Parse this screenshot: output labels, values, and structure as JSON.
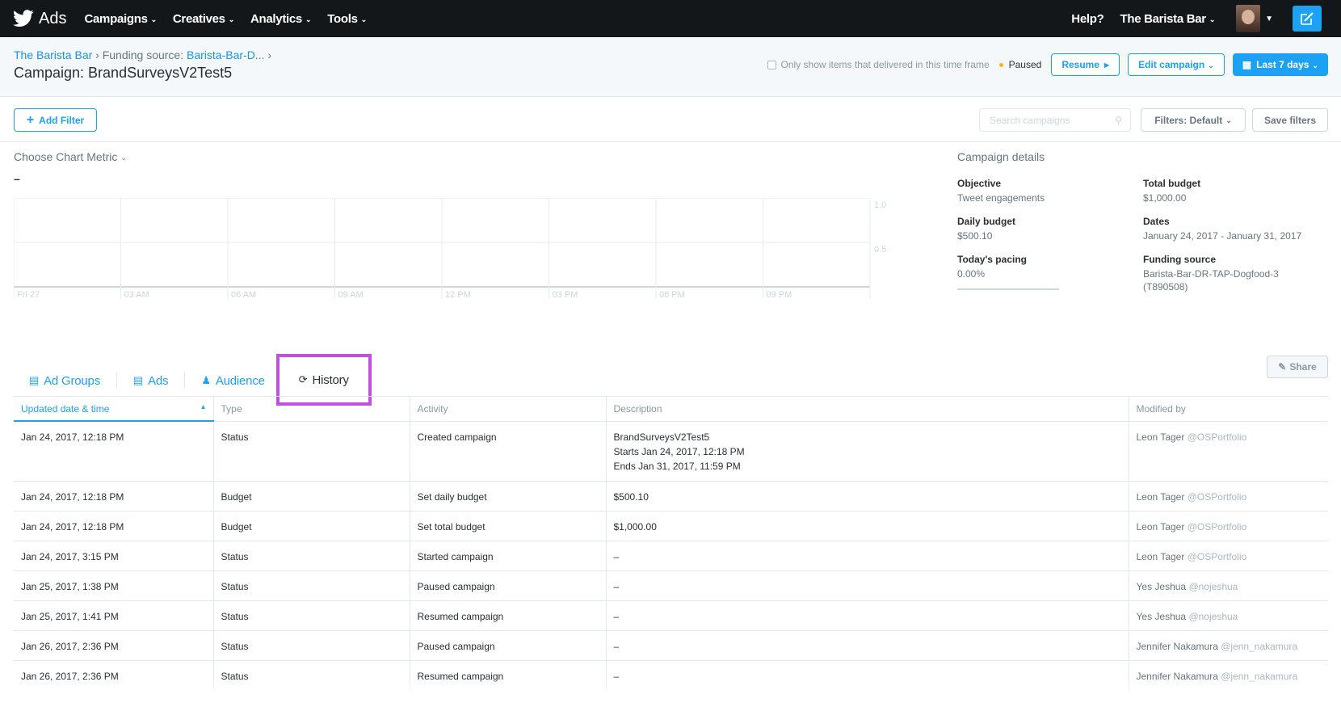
{
  "nav": {
    "brand": "Ads",
    "menu": [
      "Campaigns",
      "Creatives",
      "Analytics",
      "Tools"
    ],
    "help": "Help?",
    "account": "The Barista Bar"
  },
  "header": {
    "breadcrumb_account": "The Barista Bar",
    "breadcrumb_funding_label": "Funding source:",
    "breadcrumb_funding": "Barista-Bar-D...",
    "campaign_title": "Campaign: BrandSurveysV2Test5",
    "only_show": "Only show items that delivered in this time frame",
    "status": "Paused",
    "resume": "Resume",
    "edit_campaign": "Edit campaign",
    "date_range": "Last 7 days"
  },
  "filters": {
    "add_filter": "Add Filter",
    "search_placeholder": "Search campaigns",
    "filters_default": "Filters: Default",
    "save_filters": "Save filters"
  },
  "chart": {
    "metric_label": "Choose Chart Metric",
    "value": "–"
  },
  "chart_data": {
    "type": "line",
    "x": [
      "Fri 27",
      "03 AM",
      "06 AM",
      "09 AM",
      "12 PM",
      "03 PM",
      "06 PM",
      "09 PM"
    ],
    "series": [],
    "yticks": [
      "1.0",
      "0.5"
    ],
    "ylim": [
      0,
      1.0
    ],
    "grid": true
  },
  "details": {
    "title": "Campaign details",
    "items": [
      {
        "label": "Objective",
        "value": "Tweet engagements"
      },
      {
        "label": "Total budget",
        "value": "$1,000.00"
      },
      {
        "label": "Daily budget",
        "value": "$500.10"
      },
      {
        "label": "Dates",
        "value": "January 24, 2017 - January 31, 2017"
      },
      {
        "label": "Today's pacing",
        "value": "0.00%"
      },
      {
        "label": "Funding source",
        "value": "Barista-Bar-DR-TAP-Dogfood-3 (T890508)"
      }
    ]
  },
  "tabs": {
    "ad_groups": "Ad Groups",
    "ads": "Ads",
    "audience": "Audience",
    "history": "History",
    "share": "Share"
  },
  "table": {
    "headers": [
      "Updated date & time",
      "Type",
      "Activity",
      "Description",
      "Modified by"
    ],
    "rows": [
      {
        "date": "Jan 24, 2017, 12:18 PM",
        "type": "Status",
        "activity": "Created campaign",
        "desc1": "BrandSurveysV2Test5",
        "desc2": "Starts Jan 24, 2017, 12:18 PM",
        "desc3": "Ends Jan 31, 2017, 11:59 PM",
        "name": "Leon Tager",
        "handle": "@OSPortfolio"
      },
      {
        "date": "Jan 24, 2017, 12:18 PM",
        "type": "Budget",
        "activity": "Set daily budget",
        "desc1": "$500.10",
        "name": "Leon Tager",
        "handle": "@OSPortfolio"
      },
      {
        "date": "Jan 24, 2017, 12:18 PM",
        "type": "Budget",
        "activity": "Set total budget",
        "desc1": "$1,000.00",
        "name": "Leon Tager",
        "handle": "@OSPortfolio"
      },
      {
        "date": "Jan 24, 2017, 3:15 PM",
        "type": "Status",
        "activity": "Started campaign",
        "desc1": "–",
        "name": "Leon Tager",
        "handle": "@OSPortfolio"
      },
      {
        "date": "Jan 25, 2017, 1:38 PM",
        "type": "Status",
        "activity": "Paused campaign",
        "desc1": "–",
        "name": "Yes Jeshua",
        "handle": "@nojeshua"
      },
      {
        "date": "Jan 25, 2017, 1:41 PM",
        "type": "Status",
        "activity": "Resumed campaign",
        "desc1": "–",
        "name": "Yes Jeshua",
        "handle": "@nojeshua"
      },
      {
        "date": "Jan 26, 2017, 2:36 PM",
        "type": "Status",
        "activity": "Paused campaign",
        "desc1": "–",
        "name": "Jennifer Nakamura",
        "handle": "@jenn_nakamura"
      },
      {
        "date": "Jan 26, 2017, 2:36 PM",
        "type": "Status",
        "activity": "Resumed campaign",
        "desc1": "–",
        "name": "Jennifer Nakamura",
        "handle": "@jenn_nakamura"
      }
    ]
  },
  "colors": {
    "nav_bg": "#14171a",
    "accent": "#1da1f2",
    "highlight": "#c150e0",
    "paused_dot": "#ffad1f"
  },
  "icons": [
    "twitter-bird-icon",
    "compose-icon",
    "plus-icon",
    "search-icon",
    "history-icon",
    "ad-groups-icon",
    "ads-icon",
    "audience-icon",
    "share-icon"
  ]
}
